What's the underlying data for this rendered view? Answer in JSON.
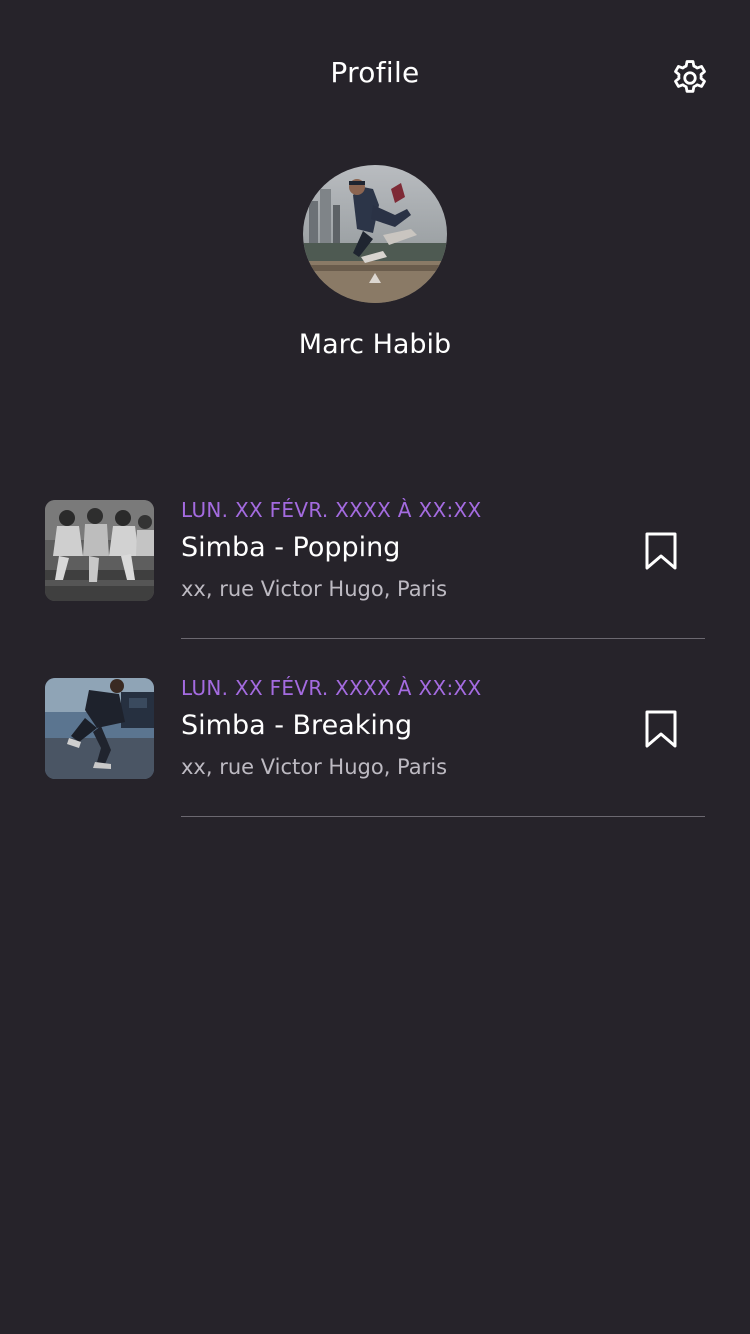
{
  "header": {
    "title": "Profile",
    "settings_icon": "gear-icon"
  },
  "profile": {
    "name": "Marc Habib",
    "avatar": "profile-photo"
  },
  "colors": {
    "background": "#26232a",
    "accent": "#a46be0",
    "text_primary": "#ffffff",
    "text_secondary": "#bdbac2",
    "divider": "#6b6870"
  },
  "events": [
    {
      "date": "LUN. XX FÉVR. XXXX À XX:XX",
      "title": "Simba - Popping",
      "address": "xx, rue Victor Hugo, Paris",
      "bookmark_icon": "bookmark-icon"
    },
    {
      "date": "LUN. XX FÉVR. XXXX À XX:XX",
      "title": "Simba - Breaking",
      "address": "xx, rue Victor Hugo, Paris",
      "bookmark_icon": "bookmark-icon"
    }
  ]
}
